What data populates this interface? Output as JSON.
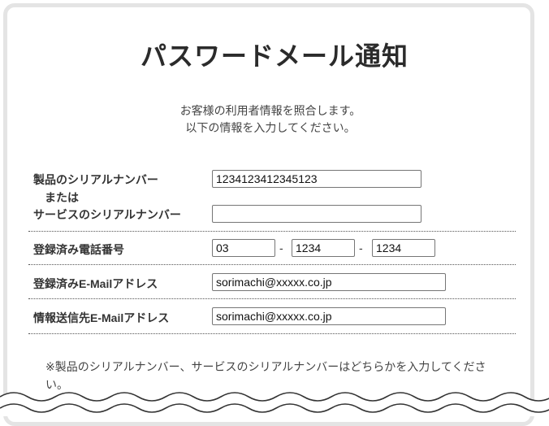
{
  "page": {
    "title": "パスワードメール通知",
    "intro_line1": "お客様の利用者情報を照合します。",
    "intro_line2": "以下の情報を入力してください。"
  },
  "form": {
    "serial_label": "製品のシリアルナンバー",
    "or_label": "または",
    "service_serial_label": "サービスのシリアルナンバー",
    "serial_value": "1234123412345123",
    "service_serial_value": "",
    "phone_label": "登録済み電話番号",
    "phone_part1": "03",
    "phone_part2": "1234",
    "phone_part3": "1234",
    "dash": "-",
    "registered_email_label": "登録済みE-Mailアドレス",
    "registered_email_value": "sorimachi@xxxxx.co.jp",
    "send_email_label": "情報送信先E-Mailアドレス",
    "send_email_value": "sorimachi@xxxxx.co.jp"
  },
  "note": {
    "text": "※製品のシリアルナンバー、サービスのシリアルナンバーはどちらかを入力してください。"
  },
  "colors": {
    "panel_border": "#e4e4e4",
    "input_border": "#767676",
    "text": "#333333"
  }
}
